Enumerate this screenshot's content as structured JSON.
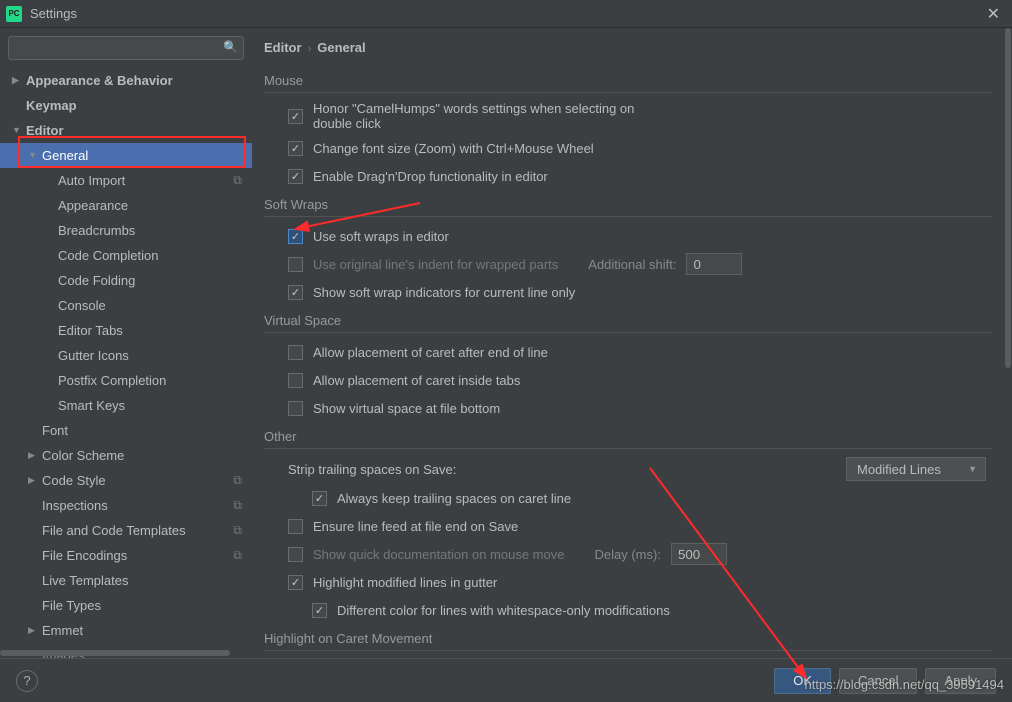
{
  "titlebar": {
    "icon_text": "PC",
    "title": "Settings"
  },
  "search": {
    "placeholder": ""
  },
  "breadcrumb": {
    "a": "Editor",
    "b": "General"
  },
  "tree": {
    "appearance": "Appearance & Behavior",
    "keymap": "Keymap",
    "editor": "Editor",
    "general": "General",
    "auto_import": "Auto Import",
    "appearance2": "Appearance",
    "breadcrumbs": "Breadcrumbs",
    "code_completion": "Code Completion",
    "code_folding": "Code Folding",
    "console": "Console",
    "editor_tabs": "Editor Tabs",
    "gutter_icons": "Gutter Icons",
    "postfix": "Postfix Completion",
    "smart_keys": "Smart Keys",
    "font": "Font",
    "color_scheme": "Color Scheme",
    "code_style": "Code Style",
    "inspections": "Inspections",
    "file_code_templates": "File and Code Templates",
    "file_encodings": "File Encodings",
    "live_templates": "Live Templates",
    "file_types": "File Types",
    "emmet": "Emmet",
    "images": "Images"
  },
  "sections": {
    "mouse": "Mouse",
    "soft_wraps": "Soft Wraps",
    "virtual_space": "Virtual Space",
    "other": "Other",
    "highlight_caret": "Highlight on Caret Movement"
  },
  "options": {
    "honor": "Honor \"CamelHumps\" words settings when selecting on double click",
    "change_font": "Change font size (Zoom) with Ctrl+Mouse Wheel",
    "enable_dnd": "Enable Drag'n'Drop functionality in editor",
    "use_soft": "Use soft wraps in editor",
    "use_orig": "Use original line's indent for wrapped parts",
    "additional_shift": "Additional shift:",
    "additional_shift_val": "0",
    "show_soft": "Show soft wrap indicators for current line only",
    "allow_caret_eol": "Allow placement of caret after end of line",
    "allow_caret_tabs": "Allow placement of caret inside tabs",
    "show_virt": "Show virtual space at file bottom",
    "strip_trailing": "Strip trailing spaces on Save:",
    "strip_value": "Modified Lines",
    "always_keep": "Always keep trailing spaces on caret line",
    "ensure_lf": "Ensure line feed at file end on Save",
    "quick_doc": "Show quick documentation on mouse move",
    "delay_label": "Delay (ms):",
    "delay_val": "500",
    "highlight_mod": "Highlight modified lines in gutter",
    "diff_color": "Different color for lines with whitespace-only modifications"
  },
  "buttons": {
    "ok": "OK",
    "cancel": "Cancel",
    "apply": "Apply",
    "help": "?"
  },
  "watermark": "https://blog.csdn.net/qq_39591494"
}
